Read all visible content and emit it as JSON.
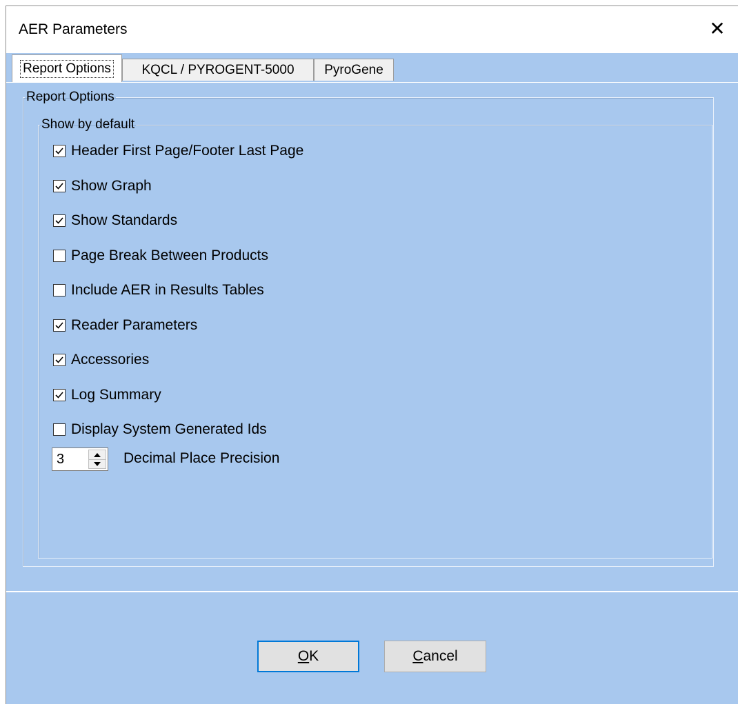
{
  "window": {
    "title": "AER Parameters",
    "close_glyph": "✕"
  },
  "tabs": [
    {
      "label": "Report Options",
      "active": true
    },
    {
      "label": "KQCL / PYROGENT-5000",
      "active": false
    },
    {
      "label": "PyroGene",
      "active": false
    }
  ],
  "report_options": {
    "group_label": "Report Options",
    "show_by_default": {
      "group_label": "Show by default",
      "items": [
        {
          "label": "Header First Page/Footer Last Page",
          "checked": true
        },
        {
          "label": "Show Graph",
          "checked": true
        },
        {
          "label": "Show Standards",
          "checked": true
        },
        {
          "label": "Page Break Between Products",
          "checked": false
        },
        {
          "label": "Include AER in Results Tables",
          "checked": false
        },
        {
          "label": "Reader Parameters",
          "checked": true
        },
        {
          "label": "Accessories",
          "checked": true
        },
        {
          "label": "Log Summary",
          "checked": true
        },
        {
          "label": "Display System Generated Ids",
          "checked": false
        }
      ]
    },
    "decimal_precision": {
      "value": "3",
      "label": "Decimal Place Precision"
    }
  },
  "buttons": {
    "ok": {
      "mnemonic": "O",
      "rest": "K"
    },
    "cancel": {
      "mnemonic": "C",
      "rest": "ancel"
    }
  },
  "colors": {
    "panel_background": "#a8c8ee",
    "default_button_border": "#0078d7"
  }
}
